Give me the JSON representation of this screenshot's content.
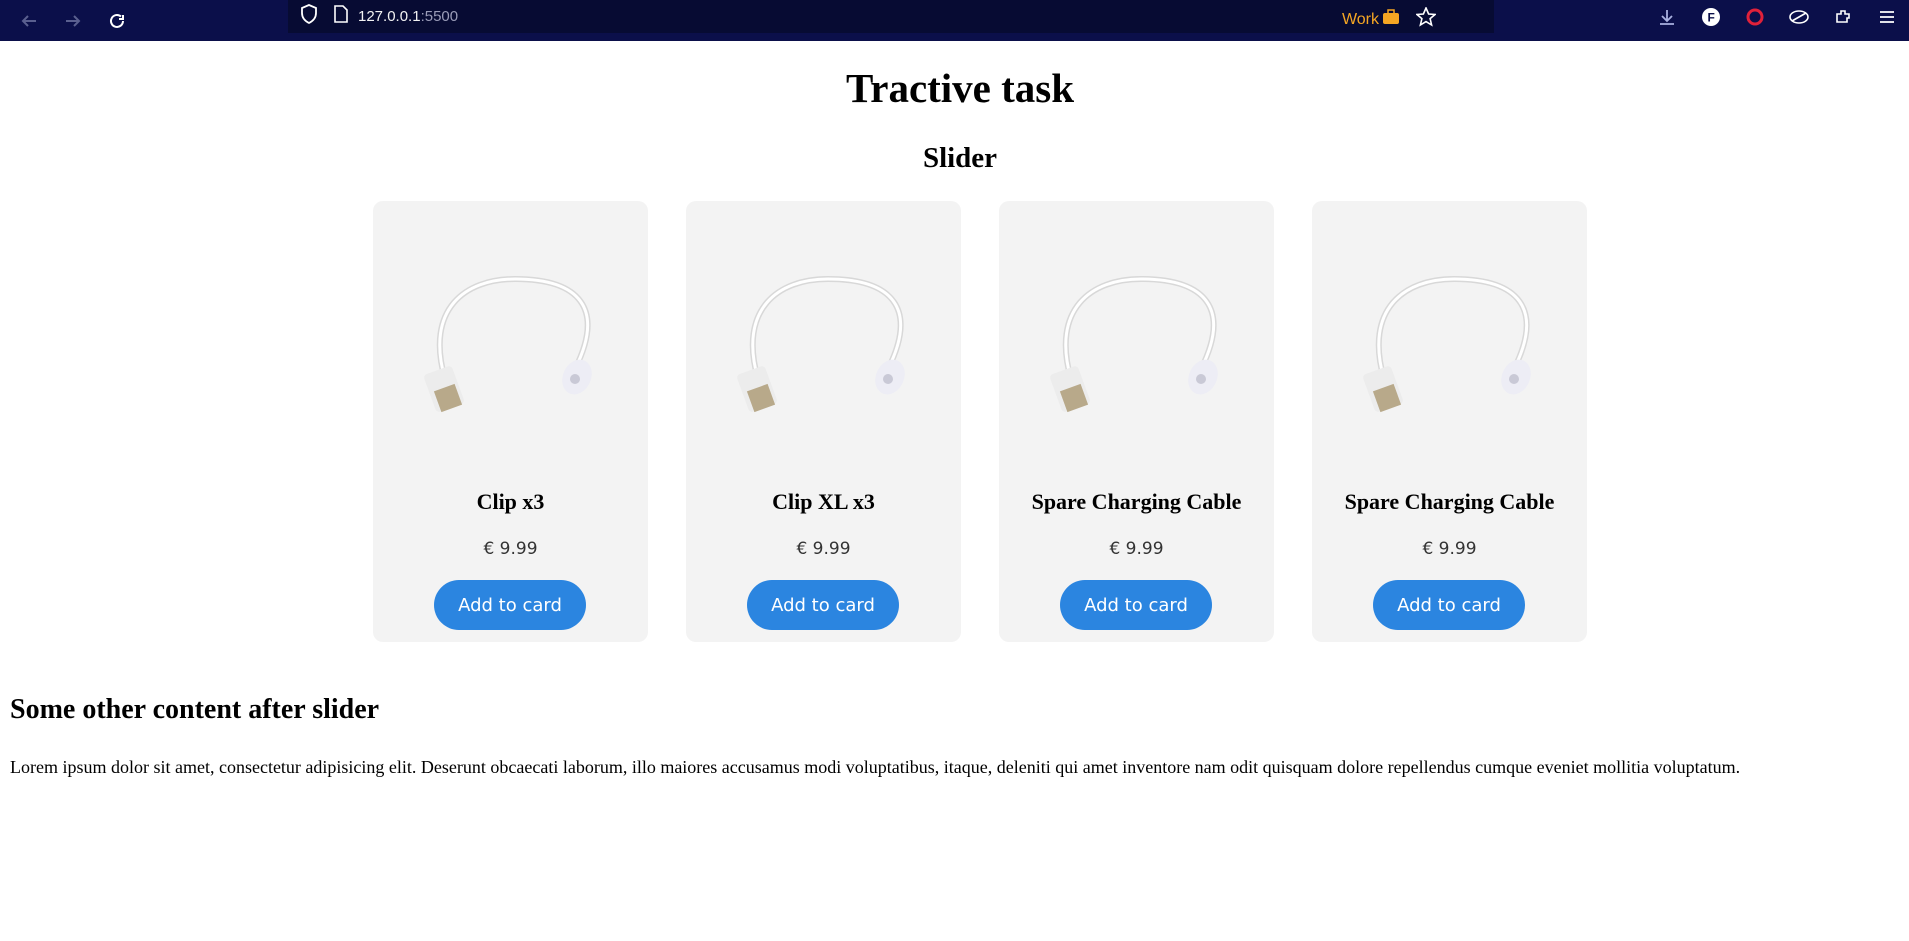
{
  "browser": {
    "url_host": "127.0.0.1",
    "url_port": ":5500",
    "container_label": "Work",
    "container_color": "#f5a623",
    "icons": [
      "back-icon",
      "forward-icon",
      "reload-icon",
      "shield-icon",
      "page-icon",
      "briefcase-icon",
      "star-icon",
      "download-icon",
      "extension-f-icon",
      "opera-icon",
      "extension-icon",
      "extensions-puzzle-icon",
      "menu-icon"
    ]
  },
  "page": {
    "title": "Tractive task",
    "slider_title": "Slider",
    "products": [
      {
        "name": "Clip x3",
        "price": "€ 9.99",
        "button": "Add to card"
      },
      {
        "name": "Clip XL x3",
        "price": "€ 9.99",
        "button": "Add to card"
      },
      {
        "name": "Spare Charging Cable",
        "price": "€ 9.99",
        "button": "Add to card"
      },
      {
        "name": "Spare Charging Cable",
        "price": "€ 9.99",
        "button": "Add to card"
      }
    ],
    "after_title": "Some other content after slider",
    "paragraph": "Lorem ipsum dolor sit amet, consectetur adipisicing elit. Deserunt obcaecati laborum, illo maiores accusamus modi voluptatibus, itaque, deleniti qui amet inventore nam odit quisquam dolore repellendus cumque eveniet mollitia voluptatum."
  },
  "colors": {
    "toolbar": "#0b0f4a",
    "button": "#2b85e0",
    "card": "#f3f3f3"
  }
}
